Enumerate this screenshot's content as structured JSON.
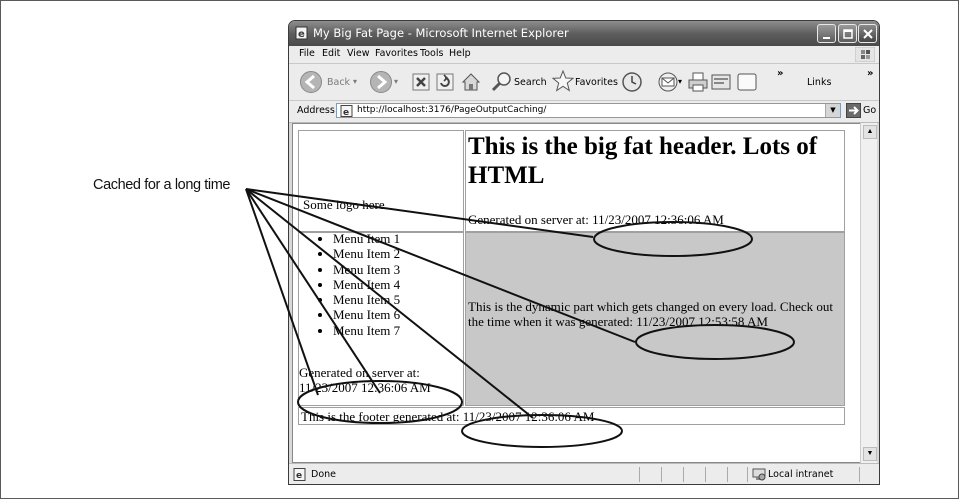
{
  "callout": {
    "label": "Cached for a long time"
  },
  "window": {
    "title": "My Big Fat Page - Microsoft Internet Explorer"
  },
  "menubar": {
    "items": [
      "File",
      "Edit",
      "View",
      "Favorites",
      "Tools",
      "Help"
    ]
  },
  "toolbar": {
    "back_label": "Back",
    "search_label": "Search",
    "favorites_label": "Favorites",
    "links_label": "Links",
    "chevron": "»"
  },
  "addressbar": {
    "label": "Address",
    "url": "http://localhost:3176/PageOutputCaching/",
    "go_label": "Go"
  },
  "page": {
    "logo_text": "Some logo here",
    "header_title": "This is the big fat header. Lots of HTML",
    "header_generated": "Generated on server at: 11/23/2007 12:36:06 AM",
    "menu_items": [
      "Menu Item 1",
      "Menu Item 2",
      "Menu Item 3",
      "Menu Item 4",
      "Menu Item 5",
      "Menu Item 6",
      "Menu Item 7"
    ],
    "menu_generated": "Generated on server at: 11/23/2007 12:36:06 AM",
    "dynamic_text": "This is the dynamic part which gets changed on every load. Check out the time when it was generated: 11/23/2007 12:53:58 AM",
    "footer_text": "This is the footer generated at: 11/23/2007 12:36:06 AM"
  },
  "statusbar": {
    "status": "Done",
    "zone": "Local intranet"
  },
  "icons": {
    "title": "ie-page-icon",
    "back": "back-arrow-icon",
    "forward": "forward-arrow-icon",
    "stop": "stop-icon",
    "refresh": "refresh-icon",
    "home": "home-icon",
    "search": "magnifier-icon",
    "favorites": "star-icon",
    "history": "history-icon",
    "mail": "mail-icon",
    "print": "printer-icon",
    "edit": "edit-icon",
    "discuss": "discuss-icon"
  }
}
